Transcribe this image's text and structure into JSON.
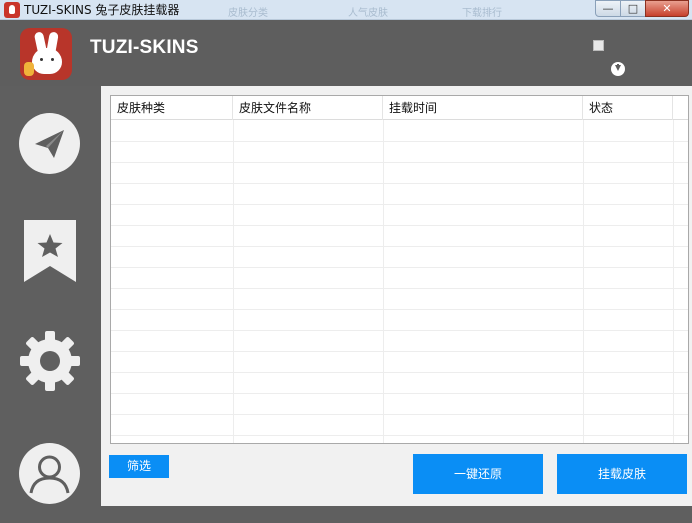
{
  "window": {
    "title": "TUZI-SKINS 兔子皮肤挂载器",
    "ghost_tabs": [
      "皮肤分类",
      "人气皮肤",
      "下载排行"
    ],
    "minimize_glyph": "—",
    "maximize_glyph": "□",
    "close_glyph": "✕"
  },
  "header": {
    "brand": "TUZI-SKINS"
  },
  "sidebar": {
    "items": [
      {
        "name": "send",
        "icon": "paper-plane-icon"
      },
      {
        "name": "favorites",
        "icon": "bookmark-star-icon"
      },
      {
        "name": "settings",
        "icon": "gear-icon"
      },
      {
        "name": "account",
        "icon": "user-icon"
      }
    ]
  },
  "table": {
    "columns": [
      "皮肤种类",
      "皮肤文件名称",
      "挂载时间",
      "状态"
    ],
    "rows": []
  },
  "buttons": {
    "filter": "筛选",
    "restore": "一键还原",
    "mount": "挂载皮肤"
  },
  "colors": {
    "accent": "#0a8ef5",
    "chrome": "#5f5f5f",
    "panel": "#f1f1f1"
  }
}
